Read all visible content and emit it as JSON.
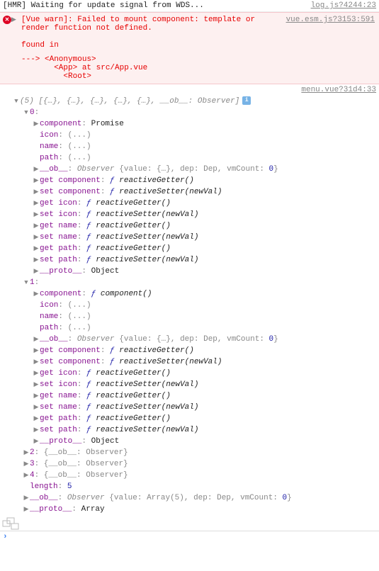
{
  "logLine": {
    "msg": "[HMR] Waiting for update signal from WDS...",
    "src": "log.js?4244:23"
  },
  "error": {
    "header": "[Vue warn]: Failed to mount component: template or render function not defined.",
    "src": "vue.esm.js?3153:591",
    "foundIn": "found in",
    "trace": "---> <Anonymous>\n       <App> at src/App.vue\n         <Root>"
  },
  "objSrc": "menu.vue?31d4:33",
  "summary": {
    "count": "(5)",
    "body": "[{…}, {…}, {…}, {…}, {…}, __ob__: Observer]"
  },
  "props": {
    "ellipsis": "(...)",
    "component": "component",
    "icon": "icon",
    "name": "name",
    "path": "path",
    "ob": "__ob__",
    "observer": "Observer",
    "value": "value",
    "dep": "dep",
    "Dep": "Dep",
    "vmCount": "vmCount",
    "zero": "0",
    "get": "get",
    "set": "set",
    "reactiveGetter": "reactiveGetter()",
    "reactiveSetter": "reactiveSetter(newVal)",
    "componentFn": "component()",
    "proto": "__proto__",
    "Object": "Object",
    "Array": "Array",
    "Array5": "Array(5)",
    "promise": "Promise",
    "length": "length",
    "five": "5",
    "f": "ƒ",
    "braces": "{…}",
    "obObserver": "__ob__: Observer"
  },
  "indices": {
    "i0": "0",
    "i1": "1",
    "i2": "2",
    "i3": "3",
    "i4": "4"
  }
}
